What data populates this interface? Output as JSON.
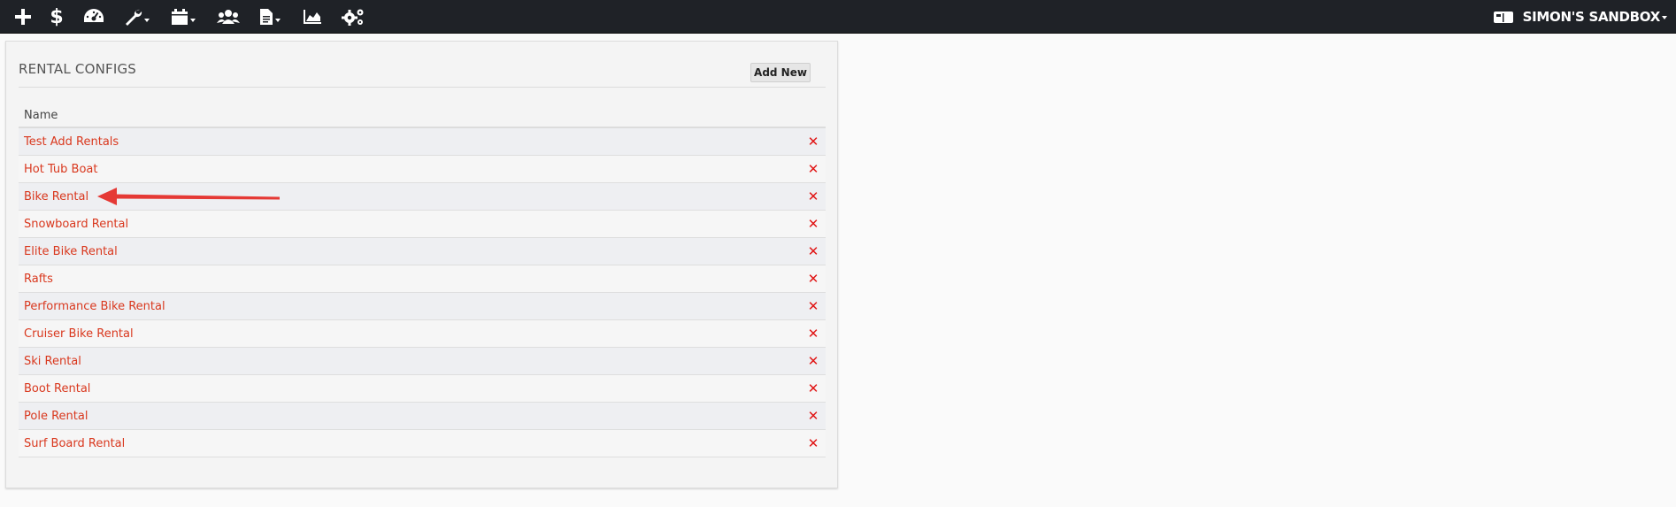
{
  "topbar": {
    "icons": [
      "plus-icon",
      "dollar-icon",
      "dashboard-gauge-icon",
      "wrench-icon",
      "calendar-icon",
      "users-icon",
      "document-icon",
      "area-chart-icon",
      "cogs-icon",
      "inbox-icon"
    ],
    "account_label": "SIMON'S SANDBOX"
  },
  "panel": {
    "title": "RENTAL CONFIGS",
    "add_label": "Add New",
    "column_header": "Name",
    "rows": [
      {
        "name": "Test Add Rentals"
      },
      {
        "name": "Hot Tub Boat"
      },
      {
        "name": "Bike Rental"
      },
      {
        "name": "Snowboard Rental"
      },
      {
        "name": "Elite Bike Rental"
      },
      {
        "name": "Rafts"
      },
      {
        "name": "Performance Bike Rental"
      },
      {
        "name": "Cruiser Bike Rental"
      },
      {
        "name": "Ski Rental"
      },
      {
        "name": "Boot Rental"
      },
      {
        "name": "Pole Rental"
      },
      {
        "name": "Surf Board Rental"
      }
    ],
    "delete_glyph": "✕"
  },
  "colors": {
    "topbar": "#1f2227",
    "link": "#d9381e",
    "delete": "#e01515",
    "annotation_arrow": "#e53935"
  }
}
